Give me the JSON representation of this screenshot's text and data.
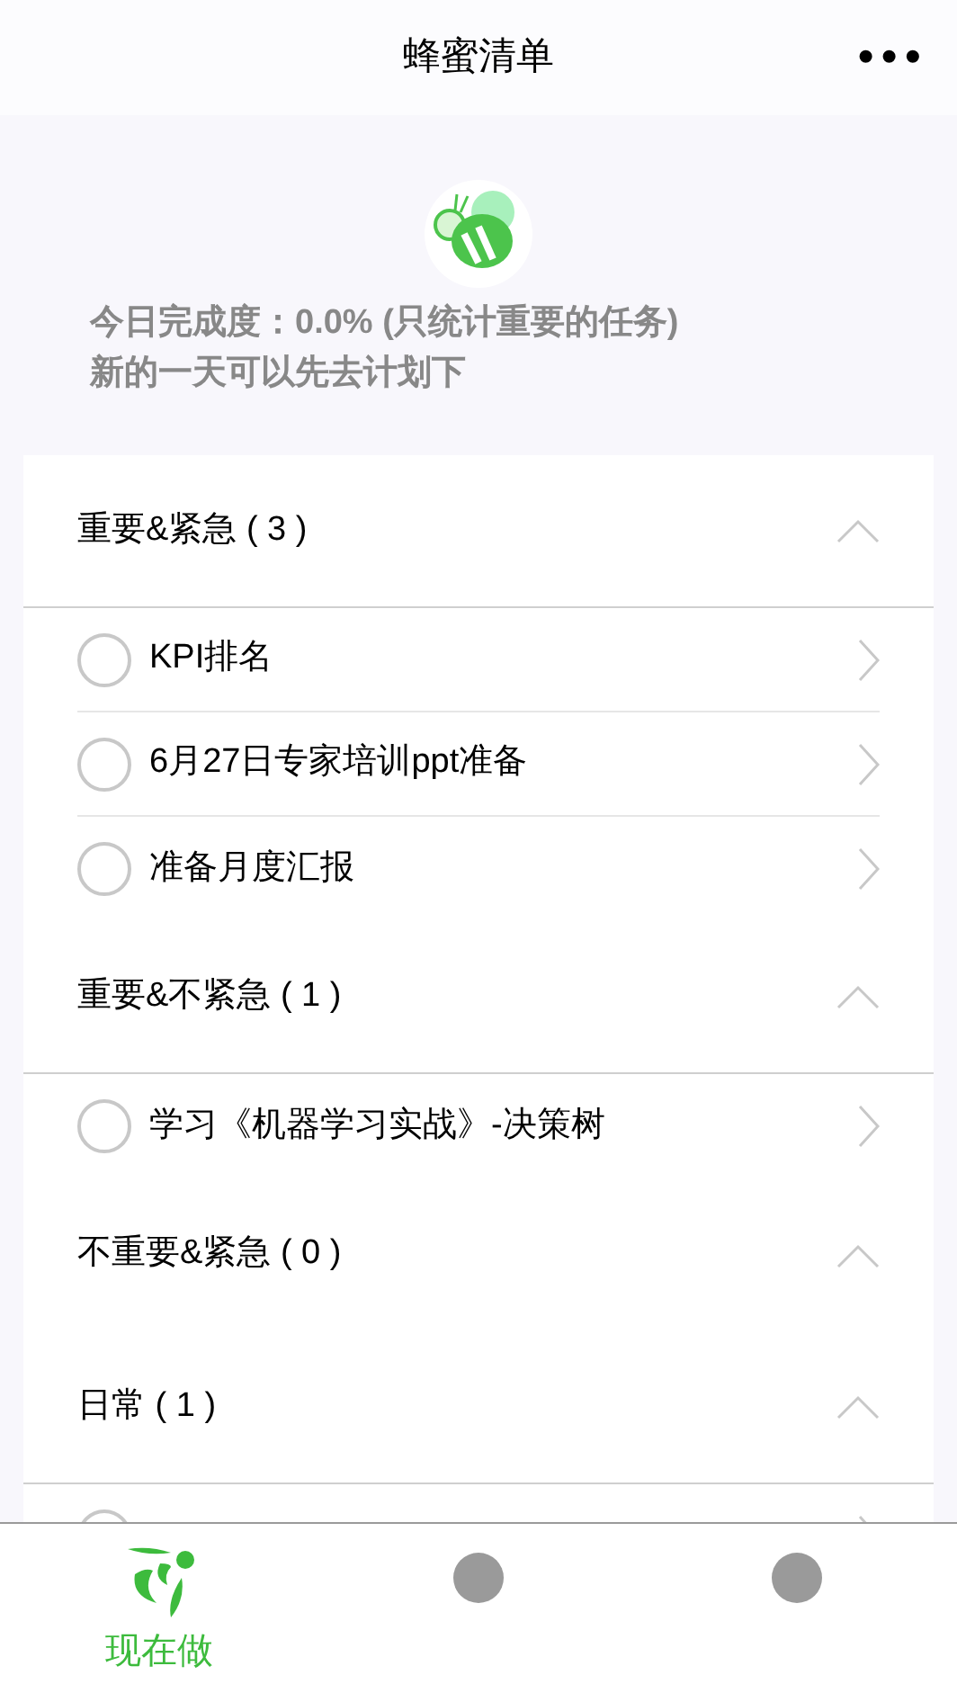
{
  "header": {
    "title": "蜂蜜清单",
    "menu": "•••"
  },
  "summary": {
    "progress": "今日完成度：0.0% (只统计重要的任务)",
    "hint": "新的一天可以先去计划下"
  },
  "sections": [
    {
      "title": "重要&紧急 ( 3 )",
      "expanded": true,
      "items": [
        {
          "title": "KPI排名",
          "checked": false
        },
        {
          "title": "6月27日专家培训ppt准备",
          "checked": false
        },
        {
          "title": "准备月度汇报",
          "checked": false
        }
      ]
    },
    {
      "title": "重要&不紧急 ( 1 )",
      "expanded": true,
      "items": [
        {
          "title": "学习《机器学习实战》-决策树",
          "checked": false
        }
      ]
    },
    {
      "title": "不重要&紧急 ( 0 )",
      "expanded": true
    },
    {
      "title": "日常 ( 1 )",
      "expanded": true,
      "items": [
        {
          "checked": false
        }
      ]
    }
  ],
  "tabs": [
    {
      "kind": "now",
      "label": "现在做",
      "selected": true
    },
    {
      "kind": "plain",
      "selected": false
    },
    {
      "kind": "plain",
      "selected": false
    }
  ]
}
